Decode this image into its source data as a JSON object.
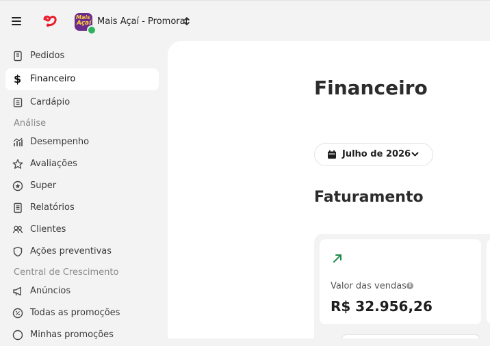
{
  "header": {
    "store_name": "Mais Açaí - Promorar",
    "store_avatar_line1": "Mais",
    "store_avatar_line2": "Açaí"
  },
  "sidebar": {
    "items_top": [
      {
        "label": "Pedidos",
        "icon": "receipt-icon"
      },
      {
        "label": "Financeiro",
        "icon": "dollar-icon",
        "active": true
      },
      {
        "label": "Cardápio",
        "icon": "menu-book-icon"
      }
    ],
    "section_analise": "Análise",
    "items_analise": [
      {
        "label": "Desempenho",
        "icon": "chart-icon"
      },
      {
        "label": "Avaliações",
        "icon": "star-icon"
      },
      {
        "label": "Super",
        "icon": "super-star-icon"
      },
      {
        "label": "Relatórios",
        "icon": "report-icon"
      },
      {
        "label": "Clientes",
        "icon": "users-icon"
      },
      {
        "label": "Ações preventivas",
        "icon": "shield-icon"
      }
    ],
    "section_crescimento": "Central de Crescimento",
    "items_crescimento": [
      {
        "label": "Anúncios",
        "icon": "megaphone-icon"
      },
      {
        "label": "Todas as promoções",
        "icon": "percent-icon"
      },
      {
        "label": "Minhas promoções",
        "icon": "tag-icon"
      }
    ]
  },
  "main": {
    "title": "Financeiro",
    "date_filter": "Julho de 2026",
    "section_title": "Faturamento",
    "card": {
      "label": "Valor das vendas",
      "info": "i",
      "value": "R$ 32.956,26"
    }
  },
  "colors": {
    "brand_red": "#ea1d2c",
    "trend_green": "#1f8a4c",
    "status_green": "#2fb35a"
  }
}
